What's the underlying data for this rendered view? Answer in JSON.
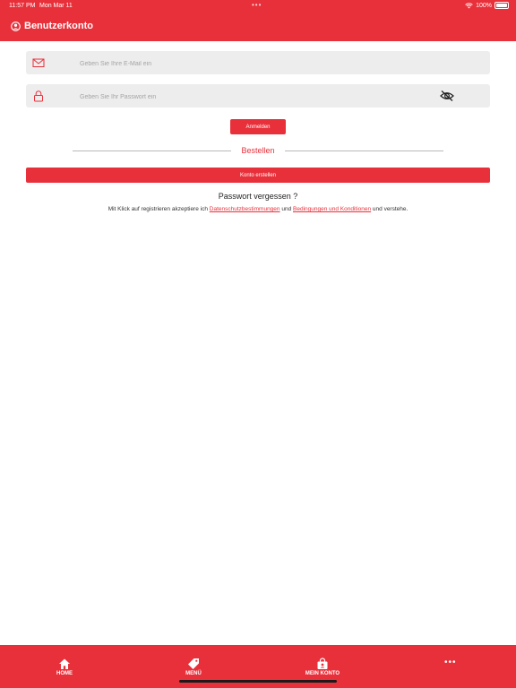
{
  "status_bar": {
    "time": "11:57 PM",
    "date": "Mon Mar 11",
    "battery": "100%"
  },
  "header": {
    "title": "Benutzerkonto",
    "icon": "user-circle-icon"
  },
  "login_form": {
    "email_placeholder": "Geben Sie Ihre E-Mail ein",
    "email_value": "",
    "password_placeholder": "Geben Sie Ihr Passwort ein",
    "password_value": "",
    "login_label": "Anmelden",
    "divider_label": "Bestellen",
    "create_account_label": "Konto erstellen",
    "forgot_password": "Passwort vergessen ?"
  },
  "terms": {
    "prefix": "Mit Klick auf registrieren akzeptiere ich ",
    "privacy_link": "Datenschutzbestimmungen",
    "middle": " und ",
    "conditions_link": "Bedingungen und Konditionen",
    "suffix": " und verstehe."
  },
  "tab_bar": {
    "items": [
      {
        "label": "HOME",
        "icon": "home-icon"
      },
      {
        "label": "MENÜ",
        "icon": "tag-icon"
      },
      {
        "label": "MEIN KONTO",
        "icon": "bag-icon"
      }
    ],
    "more": "•••"
  },
  "colors": {
    "brand": "#e8303a",
    "field_background": "#ededed"
  }
}
